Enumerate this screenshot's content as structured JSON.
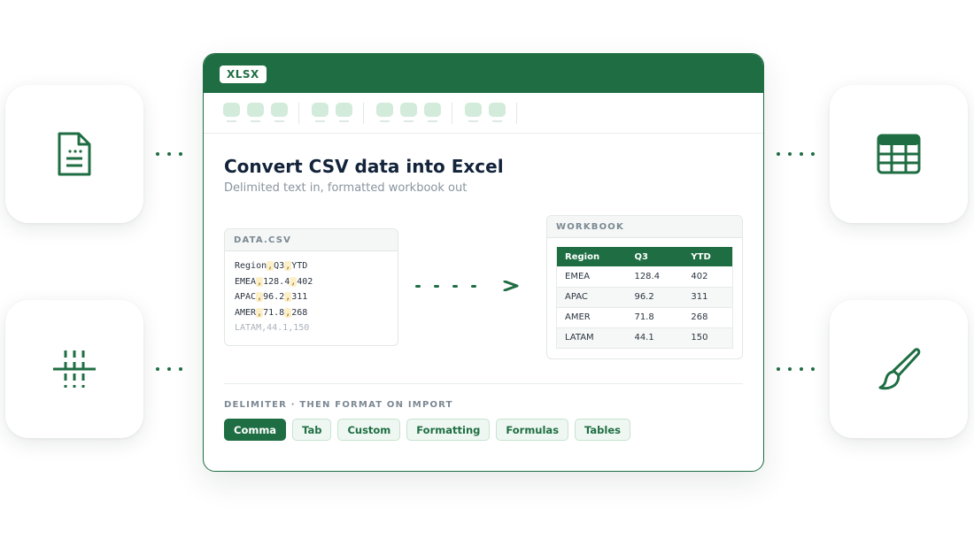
{
  "card": {
    "badge": "XLSX",
    "title": "Convert CSV data into Excel",
    "subtitle": "Delimited text in, formatted workbook out"
  },
  "csv_panel": {
    "header": "DATA.CSV",
    "lines": [
      [
        "Region",
        "Q3",
        "YTD"
      ],
      [
        "EMEA",
        "128.4",
        "402"
      ],
      [
        "APAC",
        "96.2",
        "311"
      ],
      [
        "AMER",
        "71.8",
        "268"
      ]
    ],
    "faded_line": "LATAM,44.1,150",
    "separator": ","
  },
  "workbook_panel": {
    "header": "WORKBOOK",
    "columns": [
      "Region",
      "Q3",
      "YTD"
    ],
    "rows": [
      [
        "EMEA",
        "128.4",
        "402"
      ],
      [
        "APAC",
        "96.2",
        "311"
      ],
      [
        "AMER",
        "71.8",
        "268"
      ],
      [
        "LATAM",
        "44.1",
        "150"
      ]
    ]
  },
  "flow_arrow": ">",
  "options": {
    "label": "DELIMITER · THEN FORMAT ON IMPORT",
    "chips": [
      "Comma",
      "Tab",
      "Custom",
      "Formatting",
      "Formulas",
      "Tables"
    ],
    "active": "Comma"
  },
  "side_tiles": {
    "left_top": "document-icon",
    "left_bottom": "delimiter-columns-icon",
    "right_top": "spreadsheet-grid-icon",
    "right_bottom": "paint-brush-icon"
  },
  "colors": {
    "brand": "#1f6e43",
    "chip_bg": "#eef7f1",
    "toolbar_button": "#d3ebdb"
  }
}
